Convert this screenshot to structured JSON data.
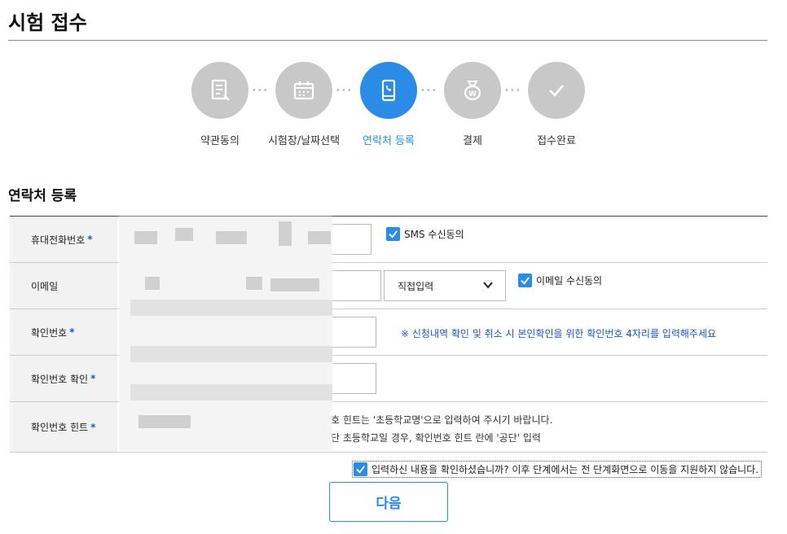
{
  "page": {
    "title": "시험 접수"
  },
  "steps": [
    {
      "label": "약관동의",
      "icon": "document-icon",
      "active": false
    },
    {
      "label": "시험장/날짜선택",
      "icon": "calendar-icon",
      "active": false
    },
    {
      "label": "연락처 등록",
      "icon": "phone-icon",
      "active": true
    },
    {
      "label": "결제",
      "icon": "money-bag-icon",
      "active": false
    },
    {
      "label": "접수완료",
      "icon": "check-icon",
      "active": false
    }
  ],
  "section": {
    "title": "연락처 등록"
  },
  "form": {
    "required_mark": "*",
    "phone": {
      "label": "휴대전화번호",
      "sms_consent": "SMS 수신동의"
    },
    "email": {
      "label": "이메일",
      "domain_select": "직접입력",
      "email_consent": "이메일 수신동의"
    },
    "verify": {
      "label": "확인번호",
      "note": "※ 신청내역 확인 및 취소 시 본인확인을 위한 확인번호 4자리를 입력해주세요"
    },
    "verify_confirm": {
      "label": "확인번호 확인"
    },
    "hint": {
      "label": "확인번호 힌트",
      "line1": "호 힌트는 '초등학교명'으로 입력하여 주시기 바랍니다.",
      "line2": "단 초등학교일 경우, 확인번호 힌트 란에 '공단' 입력"
    }
  },
  "confirm": {
    "text": "입력하신 내용을 확인하셨습니까? 이후 단계에서는 전 단계화면으로 이동을 지원하지 않습니다."
  },
  "buttons": {
    "next": "다음"
  },
  "colors": {
    "accent": "#2a8ce6",
    "inactive_step": "#c8c8c8",
    "required": "#1a56c4"
  }
}
